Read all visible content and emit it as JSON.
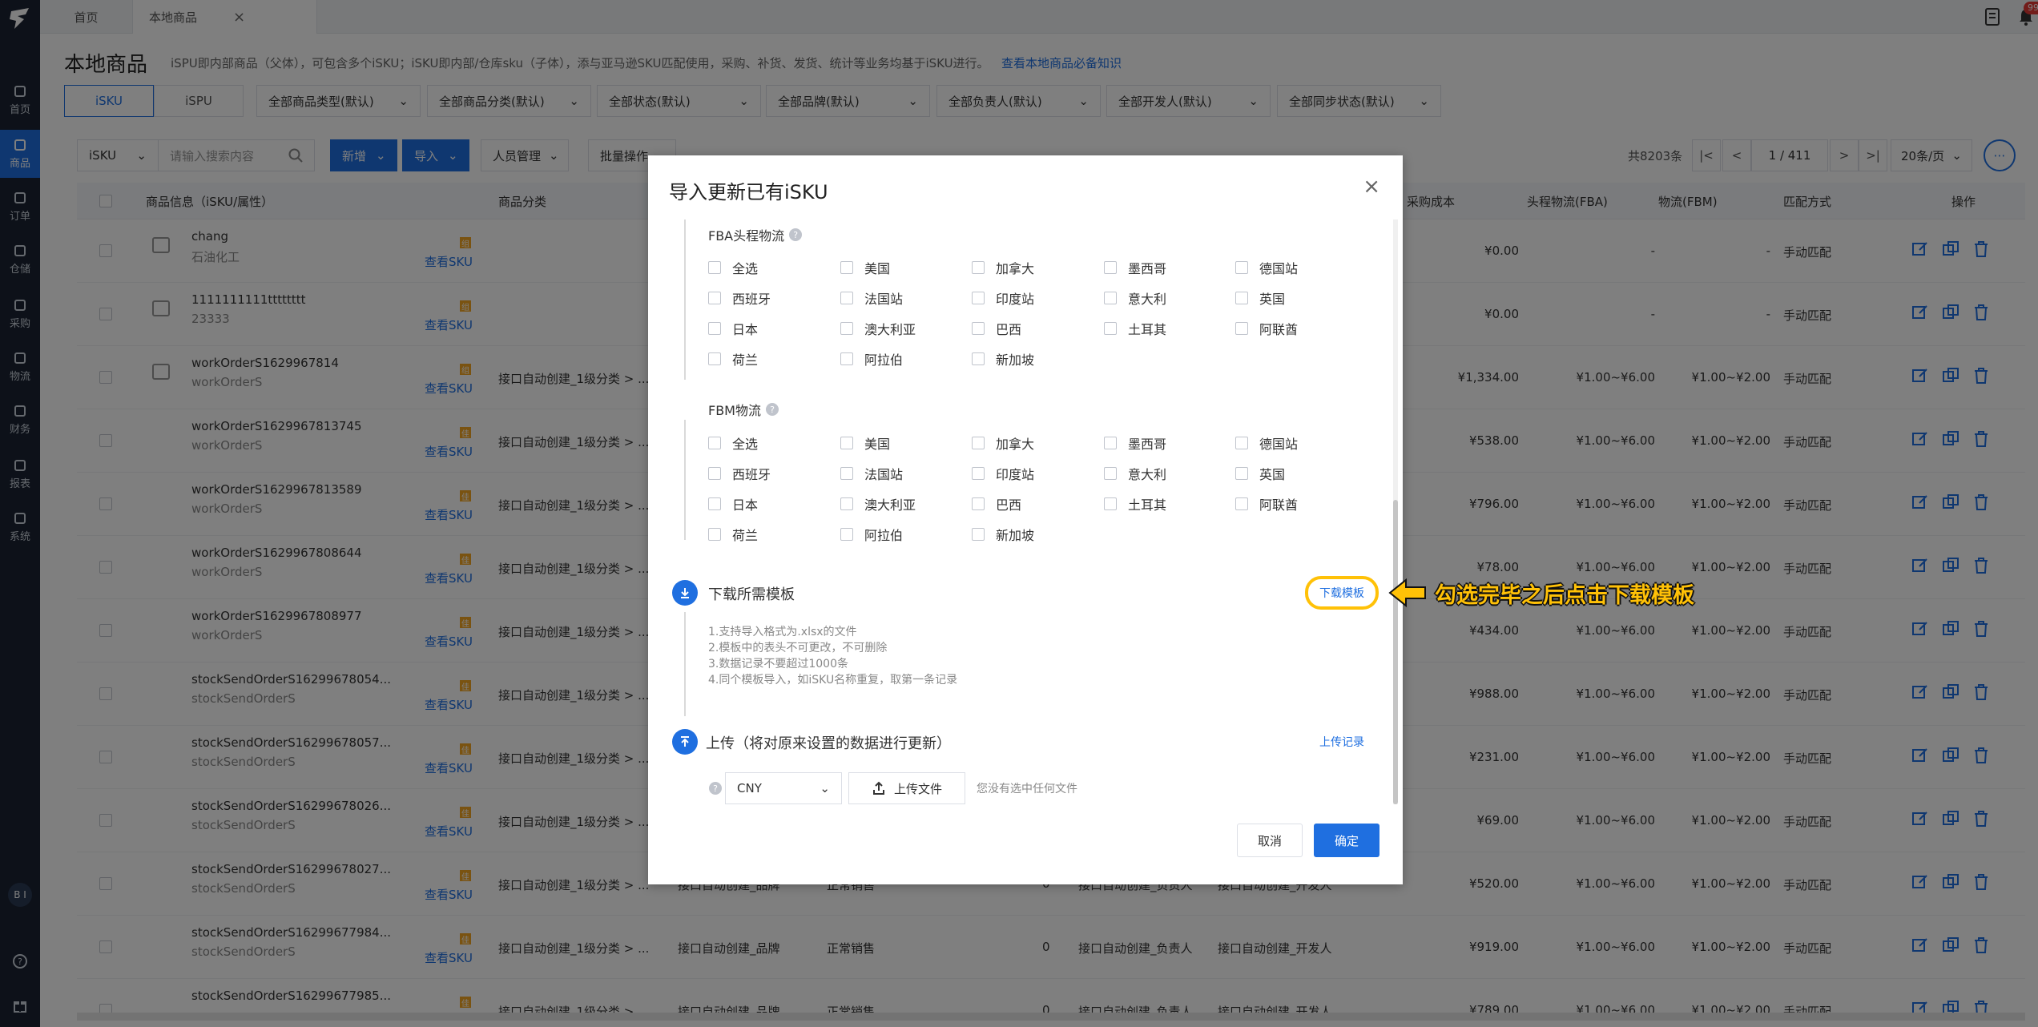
{
  "tabs": [
    {
      "label": "首页"
    },
    {
      "label": "本地商品"
    }
  ],
  "badge": "99+",
  "sidebar": {
    "items": [
      {
        "label": "首页",
        "icon": "home-icon"
      },
      {
        "label": "商品",
        "icon": "cube-icon"
      },
      {
        "label": "订单",
        "icon": "clipboard-icon"
      },
      {
        "label": "仓储",
        "icon": "warehouse-icon"
      },
      {
        "label": "采购",
        "icon": "cart-icon"
      },
      {
        "label": "物流",
        "icon": "truck-icon"
      },
      {
        "label": "财务",
        "icon": "money-icon"
      },
      {
        "label": "报表",
        "icon": "chart-icon"
      },
      {
        "label": "系统",
        "icon": "gear-icon"
      }
    ],
    "bi": "B I"
  },
  "page": {
    "title": "本地商品",
    "desc": "iSPU即内部商品（父体），可包含多个iSKU；iSKU即内部/仓库sku（子体），添与亚马逊SKU匹配使用，采购、补货、发货、统计等业务均基于iSKU进行。",
    "link": "查看本地商品必备知识"
  },
  "filters": {
    "tabs": [
      "iSKU",
      "iSPU"
    ],
    "selects": [
      "全部商品类型(默认)",
      "全部商品分类(默认)",
      "全部状态(默认)",
      "全部品牌(默认)",
      "全部负责人(默认)",
      "全部开发人(默认)",
      "全部同步状态(默认)"
    ]
  },
  "toolbar": {
    "search_type": "iSKU",
    "search_placeholder": "请输入搜索内容",
    "add": "新增",
    "import": "导入",
    "staff": "人员管理",
    "batch": "批量操作"
  },
  "pager": {
    "total": "共8203条",
    "page": "1",
    "pages": "/ 411",
    "size": "20条/页"
  },
  "table": {
    "headers": [
      "商品信息（iSKU/属性）",
      "商品分类",
      "采购成本",
      "头程物流(FBA)",
      "物流(FBM)",
      "匹配方式",
      "操作"
    ],
    "view_sku": "查看SKU",
    "rows": [
      {
        "name": "chang",
        "sub": "石油化工",
        "category": "",
        "cost": "¥0.00",
        "fba": "-",
        "fbm": "-",
        "match": "手动匹配",
        "thumb": true,
        "tag": "组"
      },
      {
        "name": "1111111111tttttttt",
        "sub": "23333",
        "category": "",
        "cost": "¥0.00",
        "fba": "-",
        "fbm": "-",
        "match": "手动匹配",
        "thumb": true,
        "tag": "组"
      },
      {
        "name": "workOrderS1629967814",
        "sub": "workOrderS",
        "category": "接口自动创建_1级分类 > ...",
        "cost": "¥1,334.00",
        "fba": "¥1.00~¥6.00",
        "fbm": "¥1.00~¥2.00",
        "match": "手动匹配",
        "thumb": true,
        "tag": "组"
      },
      {
        "name": "workOrderS1629967813745",
        "sub": "workOrderS",
        "category": "接口自动创建_1级分类 > ...",
        "cost": "¥538.00",
        "fba": "¥1.00~¥6.00",
        "fbm": "¥1.00~¥2.00",
        "match": "手动匹配",
        "thumb": false,
        "tag": "佳"
      },
      {
        "name": "workOrderS1629967813589",
        "sub": "workOrderS",
        "category": "接口自动创建_1级分类 > ...",
        "cost": "¥796.00",
        "fba": "¥1.00~¥6.00",
        "fbm": "¥1.00~¥2.00",
        "match": "手动匹配",
        "thumb": false,
        "tag": "佳"
      },
      {
        "name": "workOrderS1629967808644",
        "sub": "workOrderS",
        "category": "接口自动创建_1级分类 > ...",
        "cost": "¥78.00",
        "fba": "¥1.00~¥6.00",
        "fbm": "¥1.00~¥2.00",
        "match": "手动匹配",
        "thumb": false,
        "tag": "佳"
      },
      {
        "name": "workOrderS1629967808977",
        "sub": "workOrderS",
        "category": "接口自动创建_1级分类 > ...",
        "cost": "¥434.00",
        "fba": "¥1.00~¥6.00",
        "fbm": "¥1.00~¥2.00",
        "match": "手动匹配",
        "thumb": false,
        "tag": "佳"
      },
      {
        "name": "stockSendOrderS16299678054...",
        "sub": "stockSendOrderS",
        "category": "接口自动创建_1级分类 > ...",
        "cost": "¥988.00",
        "fba": "¥1.00~¥6.00",
        "fbm": "¥1.00~¥2.00",
        "match": "手动匹配",
        "thumb": false,
        "tag": "佳"
      },
      {
        "name": "stockSendOrderS16299678057...",
        "sub": "stockSendOrderS",
        "category": "接口自动创建_1级分类 > ...",
        "cost": "¥231.00",
        "fba": "¥1.00~¥6.00",
        "fbm": "¥1.00~¥2.00",
        "match": "手动匹配",
        "thumb": false,
        "tag": "佳"
      },
      {
        "name": "stockSendOrderS16299678026...",
        "sub": "stockSendOrderS",
        "category": "接口自动创建_1级分类 > ...",
        "cost": "¥69.00",
        "fba": "¥1.00~¥6.00",
        "fbm": "¥1.00~¥2.00",
        "match": "手动匹配",
        "thumb": false,
        "tag": "佳"
      },
      {
        "name": "stockSendOrderS16299678027...",
        "sub": "stockSendOrderS",
        "category": "接口自动创建_1级分类 > ...",
        "brand": "接口自动创建_品牌",
        "status": "正常销售",
        "qty": "0",
        "owner": "接口自动创建_负责人",
        "dev": "接口自动创建_开发人",
        "cost": "¥520.00",
        "fba": "¥1.00~¥6.00",
        "fbm": "¥1.00~¥2.00",
        "match": "手动匹配",
        "thumb": false,
        "tag": "佳"
      },
      {
        "name": "stockSendOrderS16299677984...",
        "sub": "stockSendOrderS",
        "category": "接口自动创建_1级分类 > ...",
        "brand": "接口自动创建_品牌",
        "status": "正常销售",
        "qty": "0",
        "owner": "接口自动创建_负责人",
        "dev": "接口自动创建_开发人",
        "cost": "¥919.00",
        "fba": "¥1.00~¥6.00",
        "fbm": "¥1.00~¥2.00",
        "match": "手动匹配",
        "thumb": false,
        "tag": "佳"
      },
      {
        "name": "stockSendOrderS16299677985...",
        "sub": "",
        "category": "接口自动创建_1级分类 > ...",
        "brand": "接口自动创建_品牌",
        "status": "正常销售",
        "qty": "0",
        "owner": "接口自动创建_负责人",
        "dev": "接口自动创建_开发人",
        "cost": "¥789.00",
        "fba": "¥1.00~¥6.00",
        "fbm": "¥1.00~¥2.00",
        "match": "手动匹配",
        "thumb": false,
        "tag": "佳"
      }
    ]
  },
  "modal": {
    "title": "导入更新已有iSKU",
    "fba_title": "FBA头程物流",
    "fbm_title": "FBM物流",
    "regions": [
      "全选",
      "美国",
      "加拿大",
      "墨西哥",
      "德国站",
      "西班牙",
      "法国站",
      "印度站",
      "意大利",
      "英国",
      "日本",
      "澳大利亚",
      "巴西",
      "土耳其",
      "阿联酋",
      "荷兰",
      "阿拉伯",
      "新加坡"
    ],
    "download_title": "下载所需模板",
    "download_link": "下载模板",
    "notes": [
      "1.支持导入格式为.xlsx的文件",
      "2.模板中的表头不可更改，不可删除",
      "3.数据记录不要超过1000条",
      "4.同个模板导入，如iSKU名称重复，取第一条记录"
    ],
    "upload_title": "上传（将对原来设置的数据进行更新）",
    "upload_records": "上传记录",
    "currency": "CNY",
    "upload_file": "上传文件",
    "no_file": "您没有选中任何文件",
    "cancel": "取消",
    "confirm": "确定"
  },
  "annotation": "勾选完毕之后点击下载模板"
}
